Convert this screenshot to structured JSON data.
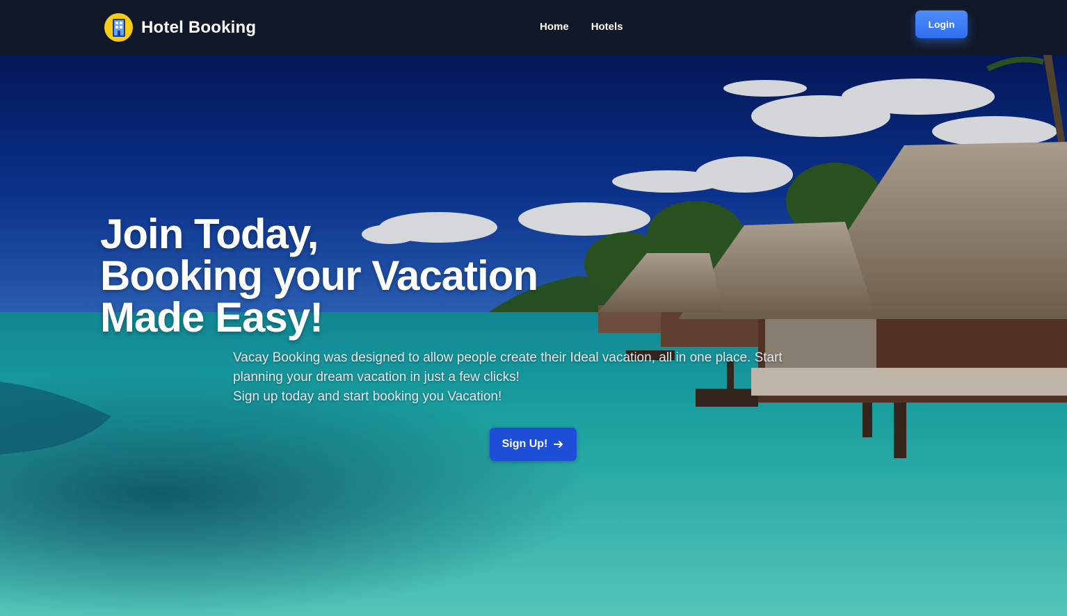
{
  "nav": {
    "brand": "Hotel Booking",
    "logo_icon": "hotel-building-icon",
    "links": [
      "Home",
      "Hotels"
    ],
    "login_label": "Login"
  },
  "hero": {
    "title_lines": [
      "Join Today,",
      "Booking your Vacation",
      "Made Easy!"
    ],
    "description_lines": [
      "Vacay Booking was designed to allow people create their Ideal vacation, all in one place. Start",
      "planning your dream vacation in just a few clicks!",
      "Sign up today and start booking you Vacation!"
    ],
    "cta_label": "Sign Up!",
    "cta_icon": "arrow-right-icon",
    "background_image": "tropical beach with overwater bungalows"
  },
  "colors": {
    "navbar_bg": "#111827",
    "logo_bg": "#facc15",
    "login_btn": "#3b82f6",
    "cta_btn": "#1d4ed8",
    "sky": "#0b2a82",
    "water": "#27c4c0"
  }
}
